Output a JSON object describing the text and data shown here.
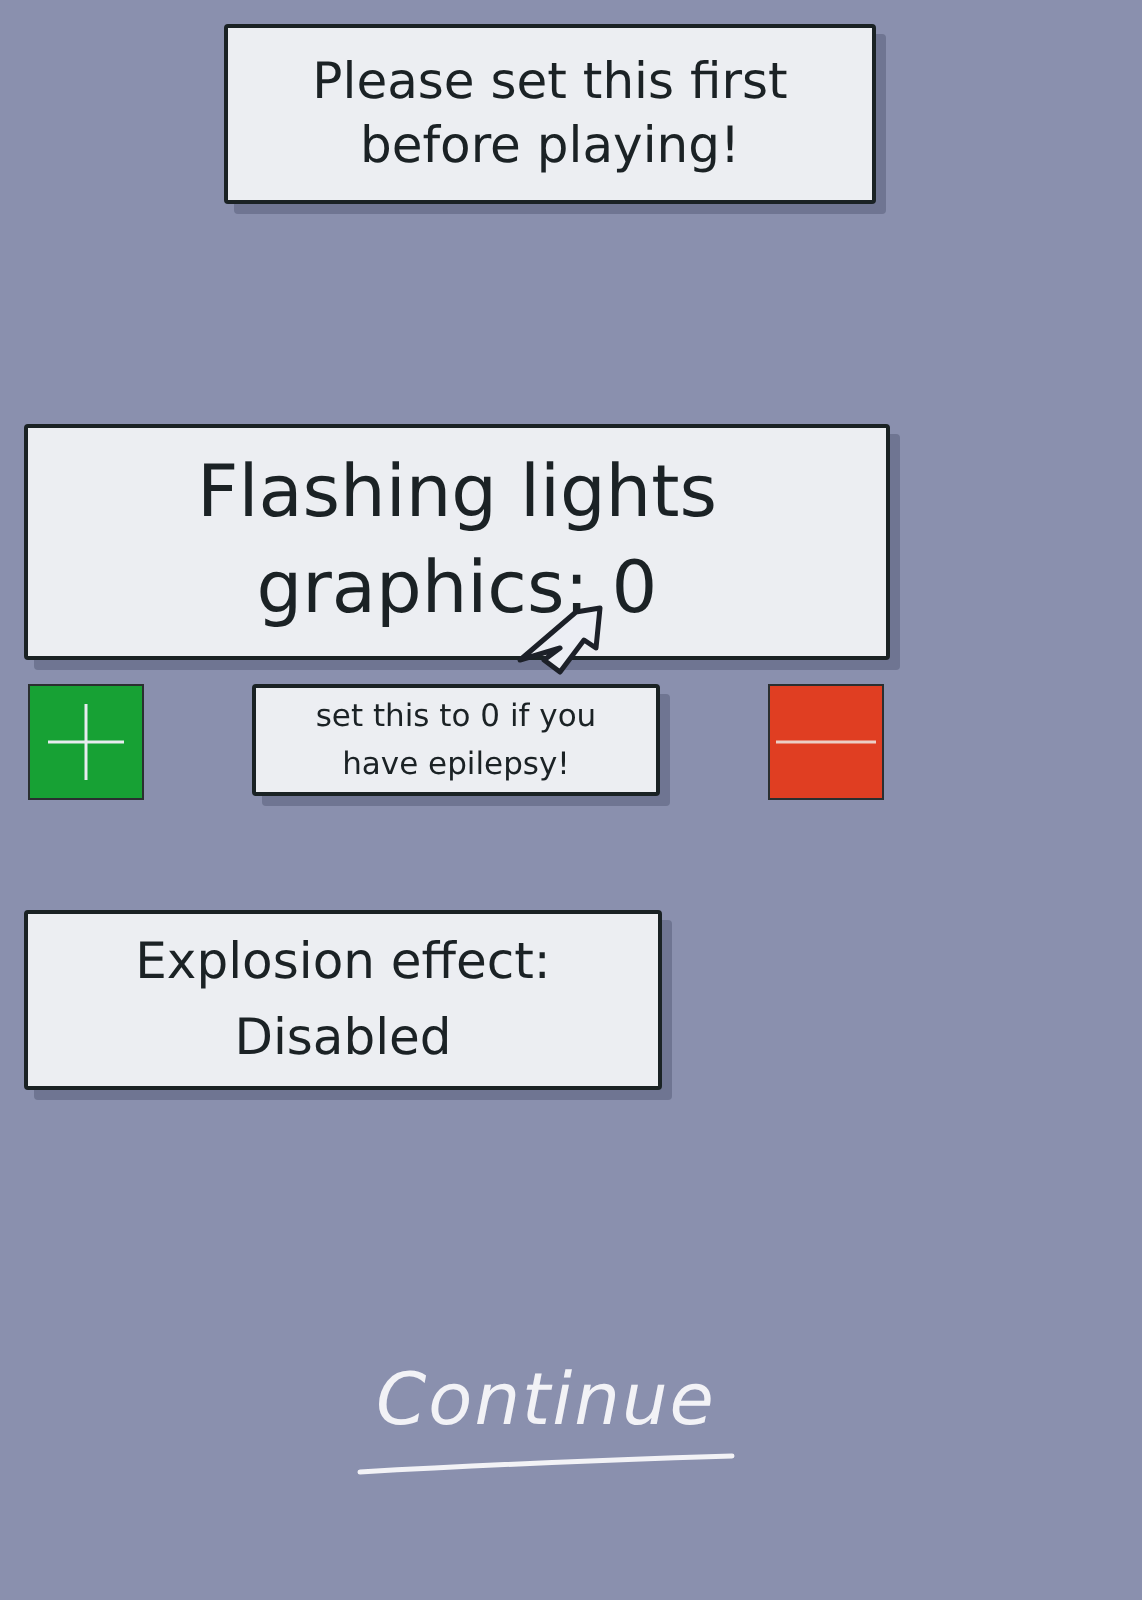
{
  "notice": {
    "text": "Please set this first before playing!"
  },
  "flashing": {
    "label": "Flashing lights graphics: 0",
    "hint": "set this to 0 if you have epilepsy!"
  },
  "explosion": {
    "label": "Explosion effect: Disabled"
  },
  "continue": {
    "label": "Continue"
  }
}
